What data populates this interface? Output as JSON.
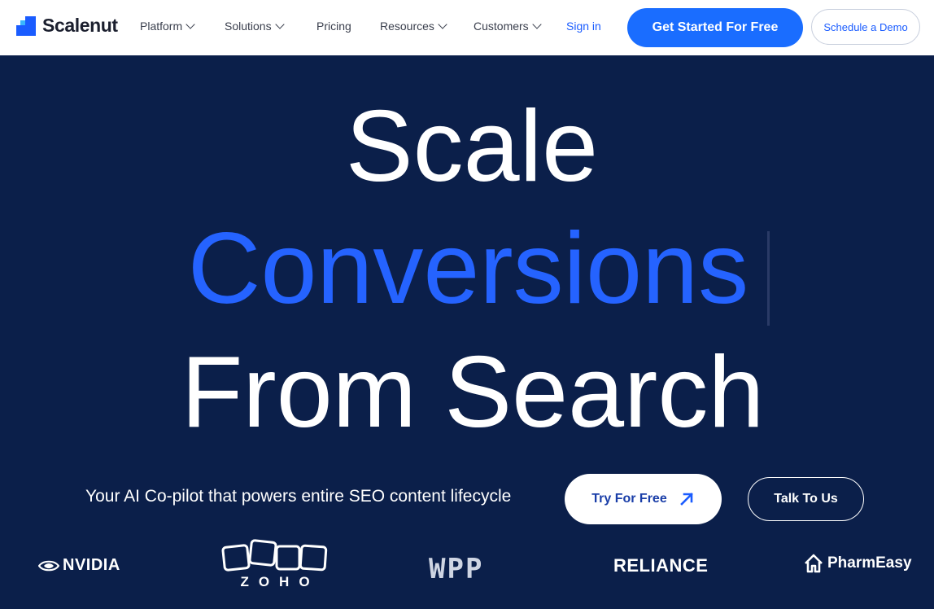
{
  "nav": {
    "brand": "Scalenut",
    "menu": [
      {
        "label": "Platform",
        "has_dropdown": true
      },
      {
        "label": "Solutions",
        "has_dropdown": true
      },
      {
        "label": "Pricing",
        "has_dropdown": false
      },
      {
        "label": "Resources",
        "has_dropdown": true
      },
      {
        "label": "Customers",
        "has_dropdown": true
      }
    ],
    "signin_label": "Sign in",
    "cta_primary": "Get Started For Free",
    "cta_secondary": "Schedule a Demo"
  },
  "hero": {
    "line1": "Scale",
    "line2": "Conversions",
    "line3": "From Search",
    "tagline": "Your AI Co-pilot that powers entire SEO content lifecycle",
    "try_label": "Try For Free",
    "talk_label": "Talk To Us"
  },
  "brands": {
    "nvidia": "NVIDIA",
    "zoho": "ZOHO",
    "wpp": "WPP",
    "reliance": "RELIANCE",
    "pharmeasy": "PharmEasy"
  },
  "colors": {
    "hero_bg": "#0b1f4a",
    "accent_blue": "#2563ff",
    "primary_button": "#1a6dff",
    "nav_bg": "#ffffff"
  },
  "icons": {
    "try_arrow": "arrow-up-right-icon",
    "nav_dropdown": "chevron-down-icon"
  }
}
